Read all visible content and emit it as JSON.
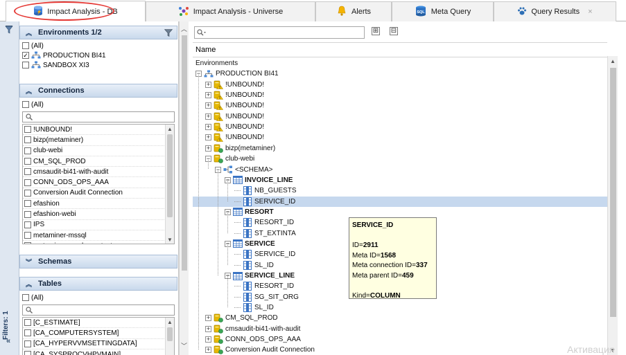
{
  "tabs": [
    {
      "label": "Impact Analysis - DB",
      "icon": "database-icon",
      "active": true
    },
    {
      "label": "Impact Analysis - Universe",
      "icon": "universe-icon",
      "active": false
    },
    {
      "label": "Alerts",
      "icon": "bell-icon",
      "active": false
    },
    {
      "label": "Meta Query",
      "icon": "sql-icon",
      "active": false
    },
    {
      "label": "Query Results",
      "icon": "paw-icon",
      "active": false,
      "closable": true,
      "close_symbol": "×"
    }
  ],
  "filter_strip": {
    "label": "Filters: 1"
  },
  "environments": {
    "title": "Environments 1/2",
    "items": [
      {
        "label": "(All)",
        "checked": false
      },
      {
        "label": "PRODUCTION BI41",
        "checked": true
      },
      {
        "label": "SANDBOX XI3",
        "checked": false
      }
    ]
  },
  "connections": {
    "title": "Connections",
    "all_label": "(All)",
    "items": [
      "!UNBOUND!",
      "bizp(metaminer)",
      "club-webi",
      "CM_SQL_PROD",
      "cmsaudit-bi41-with-audit",
      "CONN_ODS_OPS_AAA",
      "Conversion Audit Connection",
      "efashion",
      "efashion-webi",
      "IPS",
      "metaminer-mssql",
      "metaminer-oracle-mmtestac"
    ]
  },
  "schemas": {
    "title": "Schemas"
  },
  "tables": {
    "title": "Tables",
    "all_label": "(All)",
    "items": [
      "[C_ESTIMATE]",
      "[CA_COMPUTERSYSTEM]",
      "[CA_HYPERVVMSETTINGDATA]",
      "[CA_SYSPROCVHPVMAIN]"
    ]
  },
  "main": {
    "column_header": "Name",
    "expand_all": "⊞",
    "collapse_all": "⊟"
  },
  "tree": [
    {
      "label": "Environments",
      "level": 0,
      "icon": "none",
      "exp": "none"
    },
    {
      "label": "PRODUCTION BI41",
      "level": 0,
      "icon": "server-icon",
      "exp": "minus"
    },
    {
      "label": "!UNBOUND!",
      "level": 1,
      "icon": "connection-warning-icon",
      "exp": "plus"
    },
    {
      "label": "!UNBOUND!",
      "level": 1,
      "icon": "connection-warning-icon",
      "exp": "plus"
    },
    {
      "label": "!UNBOUND!",
      "level": 1,
      "icon": "connection-warning-icon",
      "exp": "plus"
    },
    {
      "label": "!UNBOUND!",
      "level": 1,
      "icon": "connection-warning-icon",
      "exp": "plus"
    },
    {
      "label": "!UNBOUND!",
      "level": 1,
      "icon": "connection-warning-icon",
      "exp": "plus"
    },
    {
      "label": "!UNBOUND!",
      "level": 1,
      "icon": "connection-warning-icon",
      "exp": "plus"
    },
    {
      "label": "bizp(metaminer)",
      "level": 1,
      "icon": "connection-icon",
      "exp": "plus"
    },
    {
      "label": "club-webi",
      "level": 1,
      "icon": "connection-icon",
      "exp": "minus"
    },
    {
      "label": "<SCHEMA>",
      "level": 2,
      "icon": "schema-icon",
      "exp": "minus"
    },
    {
      "label": "INVOICE_LINE",
      "level": 3,
      "icon": "table-icon",
      "exp": "minus",
      "bold": true
    },
    {
      "label": "NB_GUESTS",
      "level": 4,
      "icon": "column-icon",
      "exp": "none"
    },
    {
      "label": "SERVICE_ID",
      "level": 4,
      "icon": "column-icon",
      "exp": "none",
      "selected": true
    },
    {
      "label": "RESORT",
      "level": 3,
      "icon": "table-icon",
      "exp": "minus",
      "bold": true
    },
    {
      "label": "RESORT_ID",
      "level": 4,
      "icon": "column-icon",
      "exp": "none"
    },
    {
      "label": "ST_EXTINTA",
      "level": 4,
      "icon": "column-icon",
      "exp": "none"
    },
    {
      "label": "SERVICE",
      "level": 3,
      "icon": "table-icon",
      "exp": "minus",
      "bold": true
    },
    {
      "label": "SERVICE_ID",
      "level": 4,
      "icon": "column-icon",
      "exp": "none"
    },
    {
      "label": "SL_ID",
      "level": 4,
      "icon": "column-icon",
      "exp": "none"
    },
    {
      "label": "SERVICE_LINE",
      "level": 3,
      "icon": "table-icon",
      "exp": "minus",
      "bold": true
    },
    {
      "label": "RESORT_ID",
      "level": 4,
      "icon": "column-icon",
      "exp": "none"
    },
    {
      "label": "SG_SIT_ORG",
      "level": 4,
      "icon": "column-icon",
      "exp": "none"
    },
    {
      "label": "SL_ID",
      "level": 4,
      "icon": "column-icon",
      "exp": "none"
    },
    {
      "label": "CM_SQL_PROD",
      "level": 1,
      "icon": "connection-icon",
      "exp": "plus"
    },
    {
      "label": "cmsaudit-bi41-with-audit",
      "level": 1,
      "icon": "connection-icon",
      "exp": "plus"
    },
    {
      "label": "CONN_ODS_OPS_AAA",
      "level": 1,
      "icon": "connection-icon",
      "exp": "plus"
    },
    {
      "label": "Conversion Audit Connection",
      "level": 1,
      "icon": "connection-icon",
      "exp": "plus"
    }
  ],
  "tooltip": {
    "title": "SERVICE_ID",
    "id_label": "ID=",
    "id_value": "2911",
    "meta_id_label": "Meta ID=",
    "meta_id_value": "1568",
    "meta_conn_label": "Meta connection ID=",
    "meta_conn_value": "337",
    "meta_parent_label": "Meta parent ID=",
    "meta_parent_value": "459",
    "kind_label": "Kind=",
    "kind_value": "COLUMN"
  },
  "watermark": "Активация",
  "colors": {
    "accent": "#e53935",
    "selection": "#c6d8ee",
    "section_header": "#c9d9ec",
    "tooltip_bg": "#ffffe1"
  }
}
